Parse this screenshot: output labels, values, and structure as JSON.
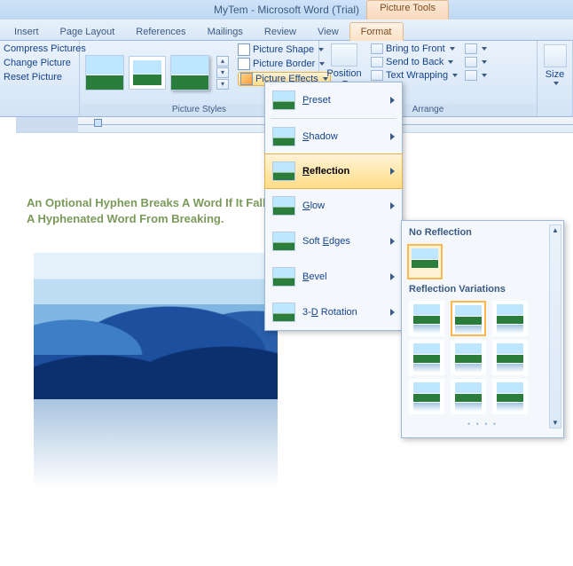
{
  "titlebar": {
    "doc_title": "MyTem - Microsoft Word (Trial)",
    "context_label": "Picture Tools"
  },
  "tabs": {
    "insert": "Insert",
    "page_layout": "Page Layout",
    "references": "References",
    "mailings": "Mailings",
    "review": "Review",
    "view": "View",
    "format": "Format"
  },
  "ribbon": {
    "adjust": {
      "compress": "Compress Pictures",
      "change": "Change Picture",
      "reset": "Reset Picture"
    },
    "picture_styles": {
      "group_label": "Picture Styles",
      "shape": "Picture Shape",
      "border": "Picture Border",
      "effects": "Picture Effects"
    },
    "arrange": {
      "group_label": "Arrange",
      "position": "Position",
      "bring_front": "Bring to Front",
      "send_back": "Send to Back",
      "wrap": "Text Wrapping"
    },
    "size": {
      "group_label": "Size",
      "label": "Size"
    }
  },
  "flyout": {
    "preset": "Preset",
    "shadow": "Shadow",
    "reflection": "Reflection",
    "glow": "Glow",
    "soft_edges": "Soft Edges",
    "bevel": "Bevel",
    "rotation": "3-D Rotation",
    "preset_key": "P",
    "shadow_key": "S",
    "reflection_key": "R",
    "glow_key": "G",
    "soft_key": "E",
    "bevel_key": "B",
    "rotation_key": "D"
  },
  "submenu": {
    "no_reflection": "No Reflection",
    "variations": "Reflection Variations"
  },
  "document": {
    "line1": "An Optional Hyphen Breaks A Word If It Falls At",
    "line2": "A Hyphenated Word From Breaking."
  }
}
